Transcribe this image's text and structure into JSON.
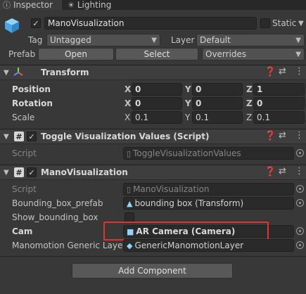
{
  "tabs": {
    "inspector": "Inspector",
    "lighting": "Lighting"
  },
  "header": {
    "object_name": "ManoVisualization",
    "static_label": "Static",
    "tag_label": "Tag",
    "tag_value": "Untagged",
    "layer_label": "Layer",
    "layer_value": "Default",
    "prefab_label": "Prefab",
    "open_button": "Open",
    "select_button": "Select",
    "overrides_value": "Overrides"
  },
  "transform": {
    "title": "Transform",
    "position_label": "Position",
    "rotation_label": "Rotation",
    "scale_label": "Scale",
    "axis_x": "X",
    "axis_y": "Y",
    "axis_z": "Z",
    "position": {
      "x": "0",
      "y": "0",
      "z": "1"
    },
    "rotation": {
      "x": "0",
      "y": "0",
      "z": "0"
    },
    "scale": {
      "x": "0.1",
      "y": "0.1",
      "z": "0.1"
    }
  },
  "toggle_component": {
    "title": "Toggle Visualization Values (Script)",
    "script_label": "Script",
    "script_value": "ToggleVisualizationValues"
  },
  "mano_component": {
    "title": "ManoVisualization",
    "script_label": "Script",
    "script_value": "ManoVisualization",
    "bounding_box_prefab_label": "Bounding_box_prefab",
    "bounding_box_prefab_value": "bounding box  (Transform)",
    "show_bounding_box_label": "Show_bounding_box",
    "cam_label": "Cam",
    "cam_value": "AR Camera (Camera)",
    "generic_layer_label": "Manomotion Generic Layer",
    "generic_layer_value": "GenericManomotionLayer"
  },
  "add_component_button": "Add Component",
  "colors": {
    "highlight_box": "#e8312a",
    "background": "#383838"
  }
}
